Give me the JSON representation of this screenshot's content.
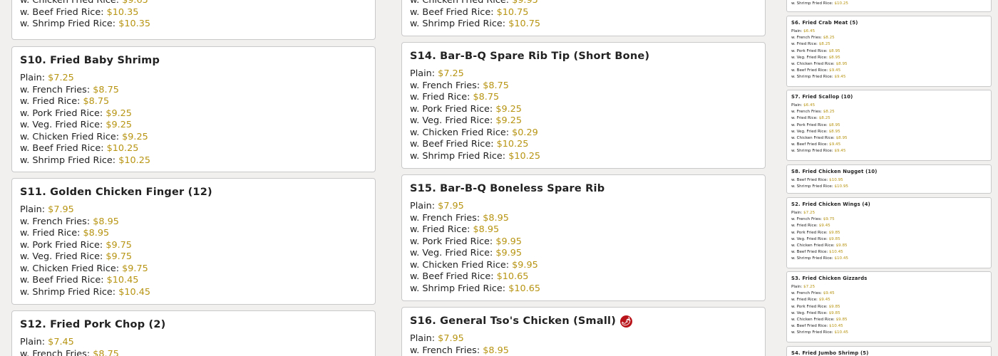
{
  "col1": {
    "partial_top": {
      "lines": [
        {
          "label": "w. Chicken Fried Rice:",
          "price": "$9.65"
        },
        {
          "label": "w. Beef Fried Rice:",
          "price": "$10.35"
        },
        {
          "label": "w. Shrimp Fried Rice:",
          "price": "$10.35"
        }
      ]
    },
    "s10": {
      "title": "S10. Fried Baby Shrimp",
      "lines": [
        {
          "label": "Plain:",
          "price": "$7.25"
        },
        {
          "label": "w. French Fries:",
          "price": "$8.75"
        },
        {
          "label": "w. Fried Rice:",
          "price": "$8.75"
        },
        {
          "label": "w. Pork Fried Rice:",
          "price": "$9.25"
        },
        {
          "label": "w. Veg. Fried Rice:",
          "price": "$9.25"
        },
        {
          "label": "w. Chicken Fried Rice:",
          "price": "$9.25"
        },
        {
          "label": "w. Beef Fried Rice:",
          "price": "$10.25"
        },
        {
          "label": "w. Shrimp Fried Rice:",
          "price": "$10.25"
        }
      ]
    },
    "s11": {
      "title": "S11. Golden Chicken Finger (12)",
      "lines": [
        {
          "label": "Plain:",
          "price": "$7.95"
        },
        {
          "label": "w. French Fries:",
          "price": "$8.95"
        },
        {
          "label": "w. Fried Rice:",
          "price": "$8.95"
        },
        {
          "label": "w. Pork Fried Rice:",
          "price": "$9.75"
        },
        {
          "label": "w. Veg. Fried Rice:",
          "price": "$9.75"
        },
        {
          "label": "w. Chicken Fried Rice:",
          "price": "$9.75"
        },
        {
          "label": "w. Beef Fried Rice:",
          "price": "$10.45"
        },
        {
          "label": "w. Shrimp Fried Rice:",
          "price": "$10.45"
        }
      ]
    },
    "s12": {
      "title": "S12. Fried Pork Chop (2)",
      "lines": [
        {
          "label": "Plain:",
          "price": "$7.45"
        },
        {
          "label": "w. French Fries:",
          "price": "$8.75"
        }
      ]
    }
  },
  "col2": {
    "partial_top": {
      "lines": [
        {
          "label": "w. Chicken Fried Rice:",
          "price": "$9.95"
        },
        {
          "label": "w. Beef Fried Rice:",
          "price": "$10.75"
        },
        {
          "label": "w. Shrimp Fried Rice:",
          "price": "$10.75"
        }
      ]
    },
    "s14": {
      "title": "S14. Bar-B-Q Spare Rib Tip (Short Bone)",
      "lines": [
        {
          "label": "Plain:",
          "price": "$7.25"
        },
        {
          "label": "w. French Fries:",
          "price": "$8.75"
        },
        {
          "label": "w. Fried Rice:",
          "price": "$8.75"
        },
        {
          "label": "w. Pork Fried Rice:",
          "price": "$9.25"
        },
        {
          "label": "w. Veg. Fried Rice:",
          "price": "$9.25"
        },
        {
          "label": "w. Chicken Fried Rice:",
          "price": "$0.29"
        },
        {
          "label": "w. Beef Fried Rice:",
          "price": "$10.25"
        },
        {
          "label": "w. Shrimp Fried Rice:",
          "price": "$10.25"
        }
      ]
    },
    "s15": {
      "title": "S15. Bar-B-Q Boneless Spare Rib",
      "lines": [
        {
          "label": "Plain:",
          "price": "$7.95"
        },
        {
          "label": "w. French Fries:",
          "price": "$8.95"
        },
        {
          "label": "w. Fried Rice:",
          "price": "$8.95"
        },
        {
          "label": "w. Pork Fried Rice:",
          "price": "$9.95"
        },
        {
          "label": "w. Veg. Fried Rice:",
          "price": "$9.95"
        },
        {
          "label": "w. Chicken Fried Rice:",
          "price": "$9.95"
        },
        {
          "label": "w. Beef Fried Rice:",
          "price": "$10.65"
        },
        {
          "label": "w. Shrimp Fried Rice:",
          "price": "$10.65"
        }
      ]
    },
    "s16": {
      "title": "S16. General Tso's Chicken (Small)",
      "spicy_icon": "🌶",
      "lines": [
        {
          "label": "Plain:",
          "price": "$7.95"
        },
        {
          "label": "w. French Fries:",
          "price": "$8.95"
        }
      ]
    }
  },
  "col3": {
    "partial_top": {
      "lines": [
        {
          "label": "w. Shrimp Fried Rice:",
          "price": "$10.25"
        }
      ]
    },
    "s6": {
      "title": "S6. Fried Crab Meat (5)",
      "lines": [
        {
          "label": "Plain:",
          "price": "$6.45"
        },
        {
          "label": "w. French Fries:",
          "price": "$8.25"
        },
        {
          "label": "w. Fried Rice:",
          "price": "$8.25"
        },
        {
          "label": "w. Pork Fried Rice:",
          "price": "$8.95"
        },
        {
          "label": "w. Veg. Fried Rice:",
          "price": "$8.95"
        },
        {
          "label": "w. Chicken Fried Rice:",
          "price": "$8.95"
        },
        {
          "label": "w. Beef Fried Rice:",
          "price": "$9.45"
        },
        {
          "label": "w. Shrimp Fried Rice:",
          "price": "$9.45"
        }
      ]
    },
    "s7": {
      "title": "S7. Fried Scallop (10)",
      "lines": [
        {
          "label": "Plain:",
          "price": "$6.45"
        },
        {
          "label": "w. French Fries:",
          "price": "$8.25"
        },
        {
          "label": "w. Fried Rice:",
          "price": "$8.25"
        },
        {
          "label": "w. Pork Fried Rice:",
          "price": "$8.95"
        },
        {
          "label": "w. Veg. Fried Rice:",
          "price": "$8.95"
        },
        {
          "label": "w. Chicken Fried Rice:",
          "price": "$8.95"
        },
        {
          "label": "w. Beef Fried Rice:",
          "price": "$9.45"
        },
        {
          "label": "w. Shrimp Fried Rice:",
          "price": "$9.45"
        }
      ]
    },
    "s8": {
      "title": "S8. Fried Chicken Nugget (10)",
      "lines": [
        {
          "label": "w. Beef Fried Rice:",
          "price": "$10.95"
        },
        {
          "label": "w. Shrimp Fried Rice:",
          "price": "$10.95"
        }
      ]
    },
    "s2": {
      "title": "S2. Fried Chicken Wings (4)",
      "lines": [
        {
          "label": "Plain:",
          "price": "$7.25"
        },
        {
          "label": "w. French Fries:",
          "price": "$9.75"
        },
        {
          "label": "w. Fried Rice:",
          "price": "$9.45"
        },
        {
          "label": "w. Pork Fried Rice:",
          "price": "$9.85"
        },
        {
          "label": "w. Veg. Fried Rice:",
          "price": "$9.85"
        },
        {
          "label": "w. Chicken Fried Rice:",
          "price": "$9.85"
        },
        {
          "label": "w. Beef Fried Rice:",
          "price": "$10.45"
        },
        {
          "label": "w. Shrimp Fried Rice:",
          "price": "$10.45"
        }
      ]
    },
    "s3": {
      "title": "S3. Fried Chicken Gizzards",
      "lines": [
        {
          "label": "Plain:",
          "price": "$7.25"
        },
        {
          "label": "w. French Fries:",
          "price": "$9.45"
        },
        {
          "label": "w. Fried Rice:",
          "price": "$9.45"
        },
        {
          "label": "w. Pork Fried Rice:",
          "price": "$9.85"
        },
        {
          "label": "w. Veg. Fried Rice:",
          "price": "$9.85"
        },
        {
          "label": "w. Chicken Fried Rice:",
          "price": "$9.85"
        },
        {
          "label": "w. Beef Fried Rice:",
          "price": "$10.45"
        },
        {
          "label": "w. Shrimp Fried Rice:",
          "price": "$10.45"
        }
      ]
    },
    "s4": {
      "title": "S4. Fried Jumbo Shrimp (5)",
      "lines": []
    }
  }
}
